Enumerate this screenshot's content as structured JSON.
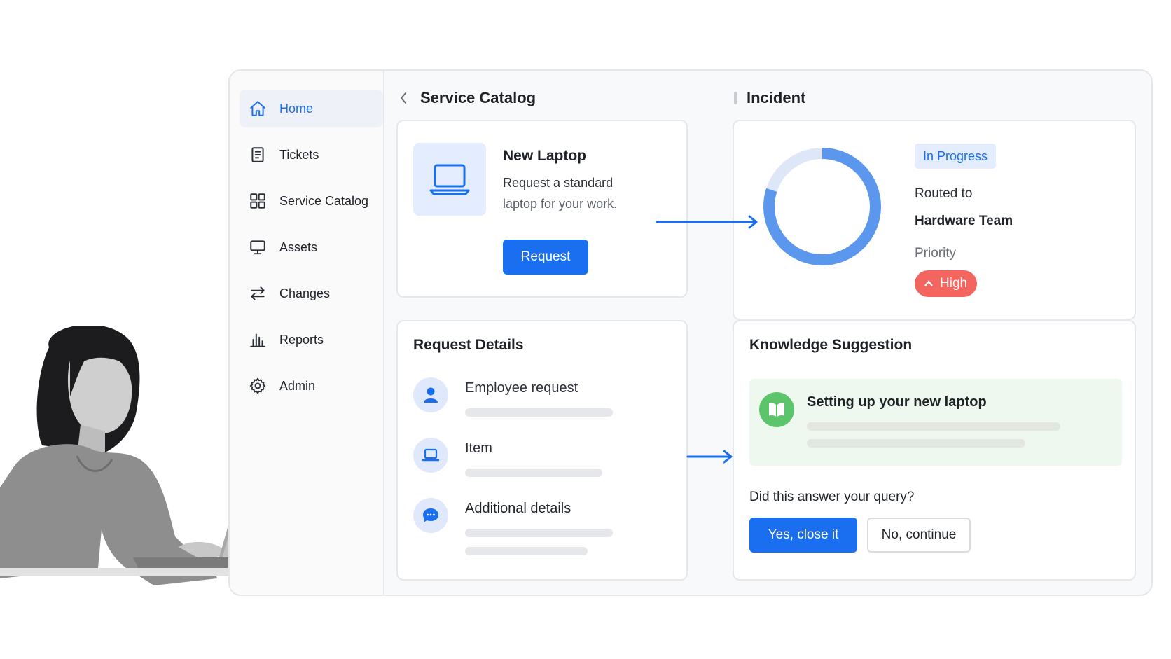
{
  "sidebar": {
    "items": [
      {
        "label": "Home",
        "icon": "home-icon",
        "active": true
      },
      {
        "label": "Tickets",
        "icon": "ticket-icon"
      },
      {
        "label": "Service Catalog",
        "icon": "grid-icon"
      },
      {
        "label": "Assets",
        "icon": "monitor-icon"
      },
      {
        "label": "Changes",
        "icon": "swap-arrows-icon"
      },
      {
        "label": "Reports",
        "icon": "bar-chart-icon"
      },
      {
        "label": "Admin",
        "icon": "gear-icon"
      }
    ]
  },
  "catalog": {
    "heading": "Service Catalog",
    "item_title": "New Laptop",
    "item_desc_line1": "Request a standard",
    "item_desc_line2": "laptop for your work.",
    "request_button": "Request"
  },
  "request_details": {
    "heading": "Request Details",
    "rows": [
      {
        "label": "Employee request",
        "icon": "user-icon"
      },
      {
        "label": "Item",
        "icon": "laptop-icon"
      },
      {
        "label": "Additional details",
        "icon": "chat-icon"
      }
    ]
  },
  "incident": {
    "heading": "Incident",
    "status": "In Progress",
    "routed_label": "Routed to",
    "routed_team": "Hardware Team",
    "priority_label": "Priority",
    "priority_value": "High",
    "progress_fraction": 0.8
  },
  "knowledge": {
    "heading": "Knowledge Suggestion",
    "article_title": "Setting up your new laptop",
    "question": "Did this answer your query?",
    "yes_button": "Yes, close it",
    "no_button": "No, continue"
  },
  "colors": {
    "accent": "#1a6ff0",
    "priority_high": "#f2665f",
    "kb_green": "#5cc46b"
  }
}
